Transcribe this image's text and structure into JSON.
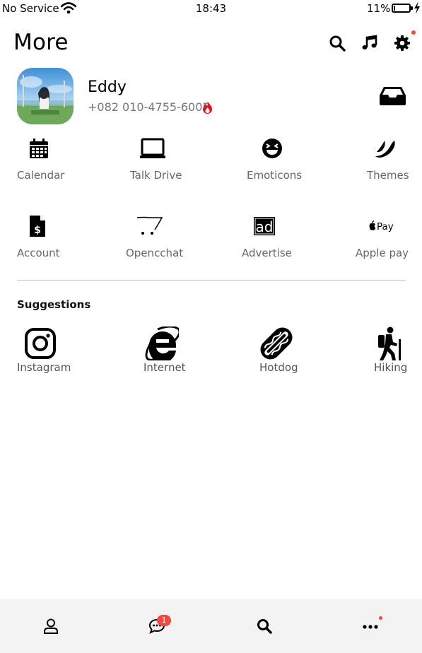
{
  "status_bar": {
    "carrier": "No Service",
    "time": "18:43",
    "battery_percent": "11%",
    "battery_level": 0.11,
    "icons": [
      "wifi-icon",
      "battery-icon",
      "charging-bolt-icon"
    ]
  },
  "header": {
    "title": "More",
    "icons": [
      "search-icon",
      "music-note-icon",
      "gear-icon"
    ],
    "settings_has_notification": true
  },
  "profile": {
    "name": "Eddy",
    "phone": "+082 010-4755-6005",
    "phone_icon": "flame-icon",
    "right_icon": "inbox-icon"
  },
  "menu": {
    "items": [
      {
        "label": "Calendar",
        "icon": "calendar-icon"
      },
      {
        "label": "Talk Drive",
        "icon": "laptop-icon"
      },
      {
        "label": "Emoticons",
        "icon": "laughing-face-icon"
      },
      {
        "label": "Themes",
        "icon": "brush-stroke-icon"
      },
      {
        "label": "Account",
        "icon": "dollar-document-icon"
      },
      {
        "label": "Opencchat",
        "icon": "cart-icon"
      },
      {
        "label": "Advertise",
        "icon": "ad-icon"
      },
      {
        "label": "Apple pay",
        "icon": "apple-pay-icon"
      }
    ]
  },
  "suggestions": {
    "title": "Suggestions",
    "items": [
      {
        "label": "Instagram",
        "icon": "instagram-icon"
      },
      {
        "label": "Internet",
        "icon": "internet-explorer-icon"
      },
      {
        "label": "Hotdog",
        "icon": "hotdog-icon"
      },
      {
        "label": "Hiking",
        "icon": "hiking-icon"
      }
    ]
  },
  "tabbar": {
    "icons": [
      "person-icon",
      "chat-icon",
      "search-icon",
      "more-dots-icon"
    ],
    "chat_badge": "1",
    "more_has_notification": true
  },
  "colors": {
    "accent_red": "#f04a3f",
    "text_primary": "#111111",
    "text_secondary": "#666666",
    "tabbar_bg": "#f3f3f3",
    "flame": "#e8101a"
  }
}
